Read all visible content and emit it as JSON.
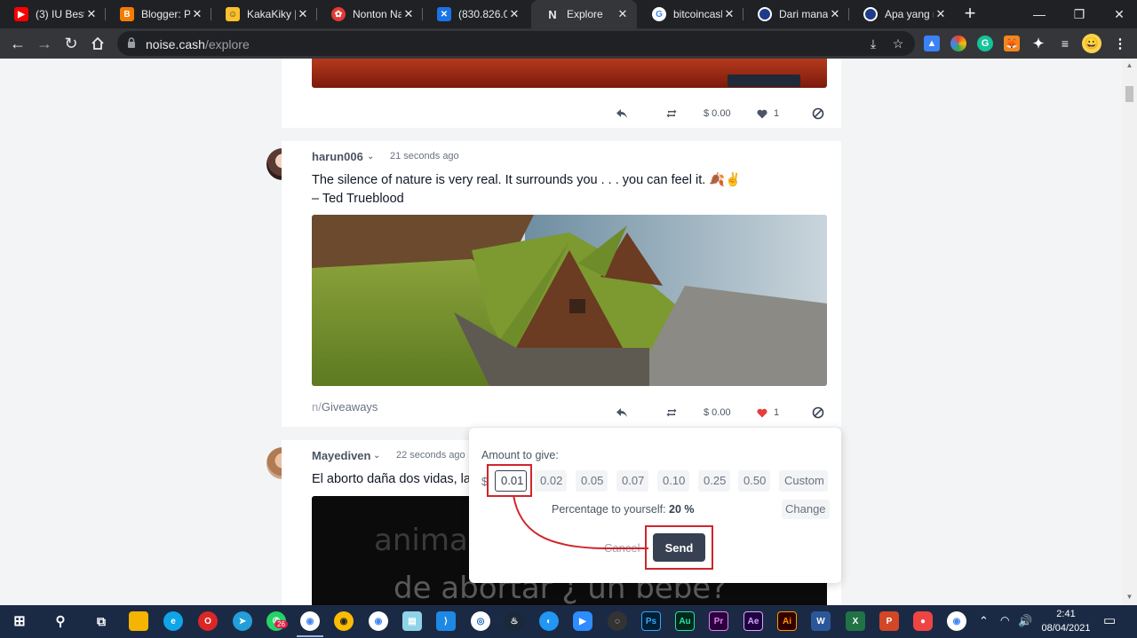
{
  "browser": {
    "tabs": [
      {
        "label": "(3) IU Best",
        "active": false,
        "favicon_color": "#ff0000"
      },
      {
        "label": "Blogger: Po",
        "active": false,
        "favicon_color": "#f57c00"
      },
      {
        "label": "KakaKiky |",
        "active": false,
        "favicon_color": "#fbc02d"
      },
      {
        "label": "Nonton Na",
        "active": false,
        "favicon_color": "#e53935"
      },
      {
        "label": "(830.826.00",
        "active": false,
        "favicon_color": "#1a73e8"
      },
      {
        "label": "Explore",
        "active": true,
        "favicon_color": "#35363a"
      },
      {
        "label": "bitcoincash",
        "active": false,
        "favicon_color": "#ffffff"
      },
      {
        "label": "Dari mana",
        "active": false,
        "favicon_color": "#3b82f6"
      },
      {
        "label": "Apa yang m",
        "active": false,
        "favicon_color": "#3b82f6"
      }
    ],
    "url_host": "noise.cash",
    "url_path": "/explore"
  },
  "feed": {
    "post1": {
      "actions": {
        "tip_amount": "$ 0.00",
        "likes": "1"
      }
    },
    "post2": {
      "username": "harun006",
      "timestamp": "21 seconds ago",
      "text_line1": "The silence of nature is very real. It surrounds you . . . you can feel it. 🍂✌",
      "text_line2": "– Ted Trueblood",
      "community_prefix": "n/",
      "community": "Giveaways",
      "actions": {
        "tip_amount": "$ 0.00",
        "likes": "1"
      }
    },
    "post3": {
      "username": "Mayediven",
      "timestamp": "22 seconds ago",
      "text": "El aborto daña dos vidas, la",
      "image_text_line1": "anima",
      "image_text_line2": "de abortar ¿ un bebe?"
    }
  },
  "tip_popover": {
    "label": "Amount to give:",
    "currency": "$",
    "amounts": [
      "0.01",
      "0.02",
      "0.05",
      "0.07",
      "0.10",
      "0.25",
      "0.50"
    ],
    "selected_amount": "0.01",
    "custom_label": "Custom",
    "percentage_label": "Percentage to yourself:",
    "percentage_value": "20 %",
    "change_label": "Change",
    "cancel_label": "Cancel",
    "send_label": "Send"
  },
  "taskbar": {
    "time": "2:41",
    "date": "08/04/2021",
    "notification_badge": "26"
  },
  "colors": {
    "accent_dark": "#374151",
    "annotation_red": "#d0252b",
    "liked_heart": "#e53e3e"
  }
}
